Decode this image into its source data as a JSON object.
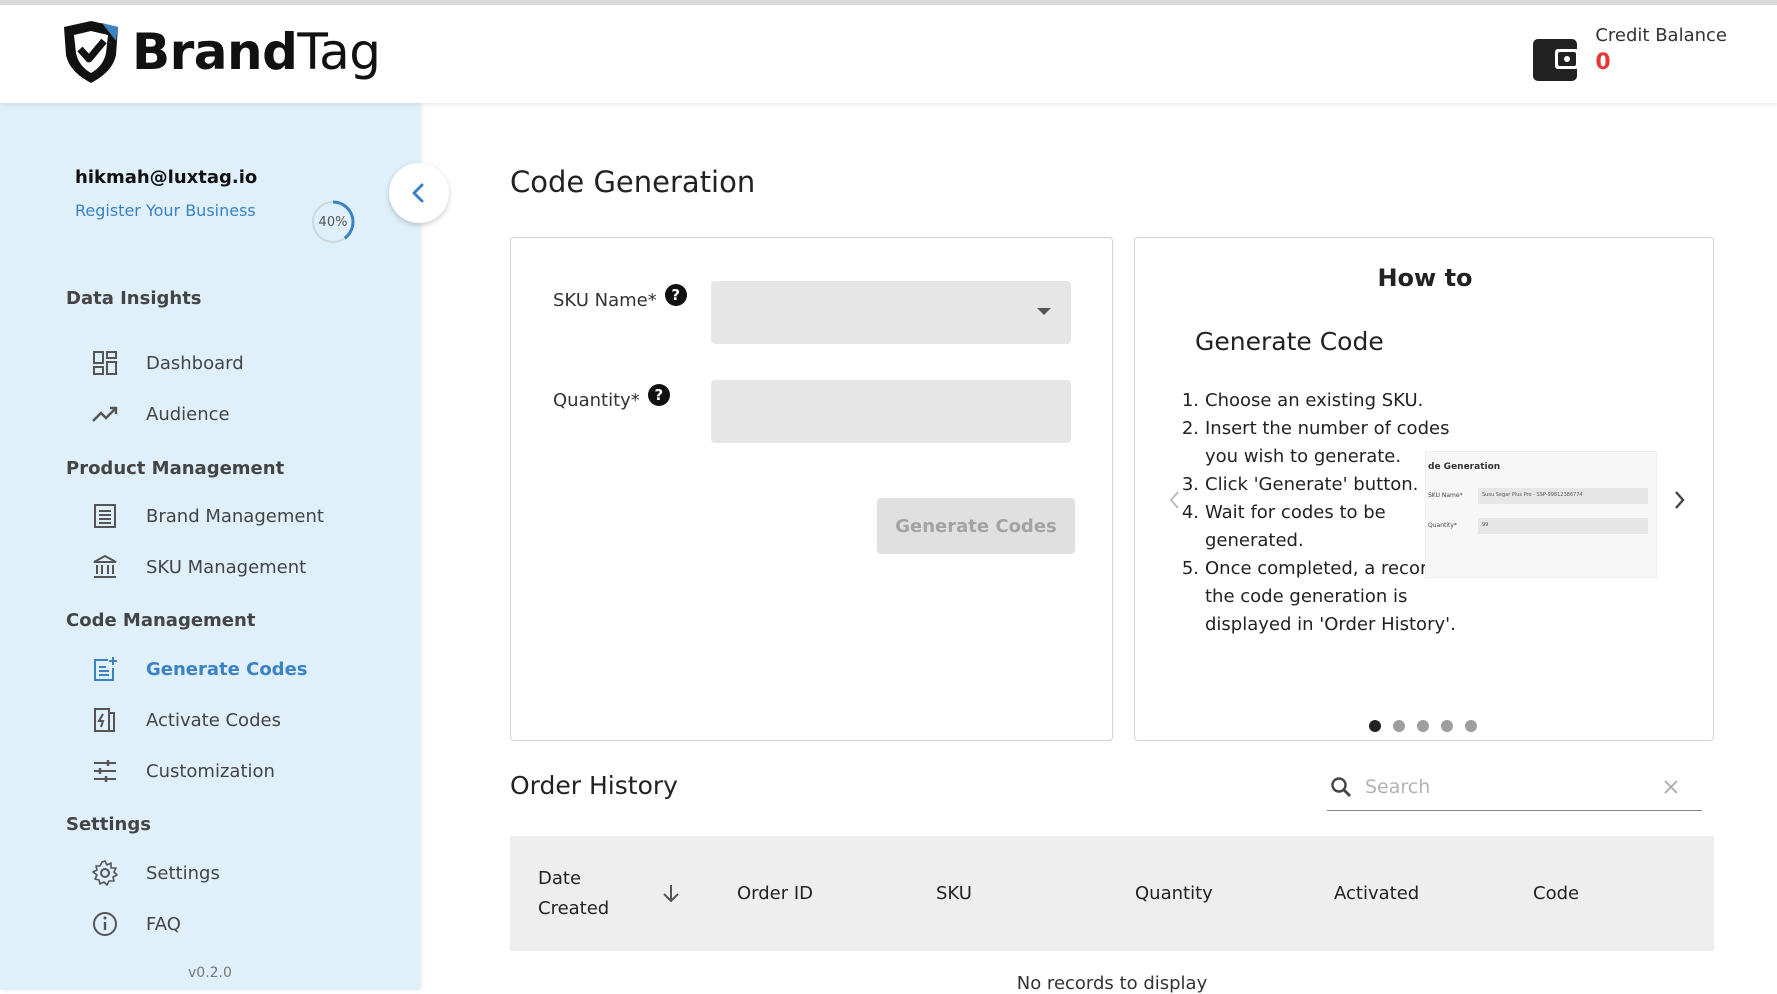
{
  "header": {
    "brand_bold": "Brand",
    "brand_light": "Tag",
    "credit_label": "Credit Balance",
    "credit_value": "0"
  },
  "sidebar": {
    "user_email": "hikmah@luxtag.io",
    "register_label": "Register Your Business",
    "progress_label": "40%",
    "progress_fraction": 0.4,
    "sections": {
      "data_insights": "Data Insights",
      "product_management": "Product Management",
      "code_management": "Code Management",
      "settings": "Settings"
    },
    "items": {
      "dashboard": "Dashboard",
      "audience": "Audience",
      "brand_management": "Brand Management",
      "sku_management": "SKU Management",
      "generate_codes": "Generate Codes",
      "activate_codes": "Activate Codes",
      "customization": "Customization",
      "settings": "Settings",
      "faq": "FAQ"
    },
    "version": "v0.2.0"
  },
  "main": {
    "title": "Code Generation",
    "form": {
      "sku_label": "SKU Name*",
      "quantity_label": "Quantity*",
      "help_glyph": "?",
      "generate_button": "Generate Codes"
    },
    "howto": {
      "title": "How to",
      "subtitle": "Generate Code",
      "steps": [
        {
          "n": "1.",
          "text": "Choose an existing SKU."
        },
        {
          "n": "2.",
          "text": "Insert the number of codes you wish to generate."
        },
        {
          "n": "3.",
          "text": "Click 'Generate' button."
        },
        {
          "n": "4.",
          "text": "Wait for codes to be generated."
        },
        {
          "n": "5.",
          "text": "Once completed, a record of the code generation is displayed in 'Order History'."
        }
      ],
      "preview": {
        "title": "de Generation",
        "sku_label": "SKU Name*",
        "sku_value": "Susu Segar Plus Pro - SSP-99812386774",
        "qty_label": "Quantity*",
        "qty_value": "99"
      },
      "slide_count": 5,
      "active_slide": 0
    },
    "order_history": {
      "title": "Order History",
      "search_placeholder": "Search",
      "columns": {
        "date": "Date Created",
        "order_id": "Order ID",
        "sku": "SKU",
        "quantity": "Quantity",
        "activated": "Activated",
        "code": "Code"
      },
      "empty_message": "No records to display"
    }
  },
  "colors": {
    "sidebar_bg": "#dff0fb",
    "accent": "#3b82c4",
    "credit": "#e53935"
  }
}
